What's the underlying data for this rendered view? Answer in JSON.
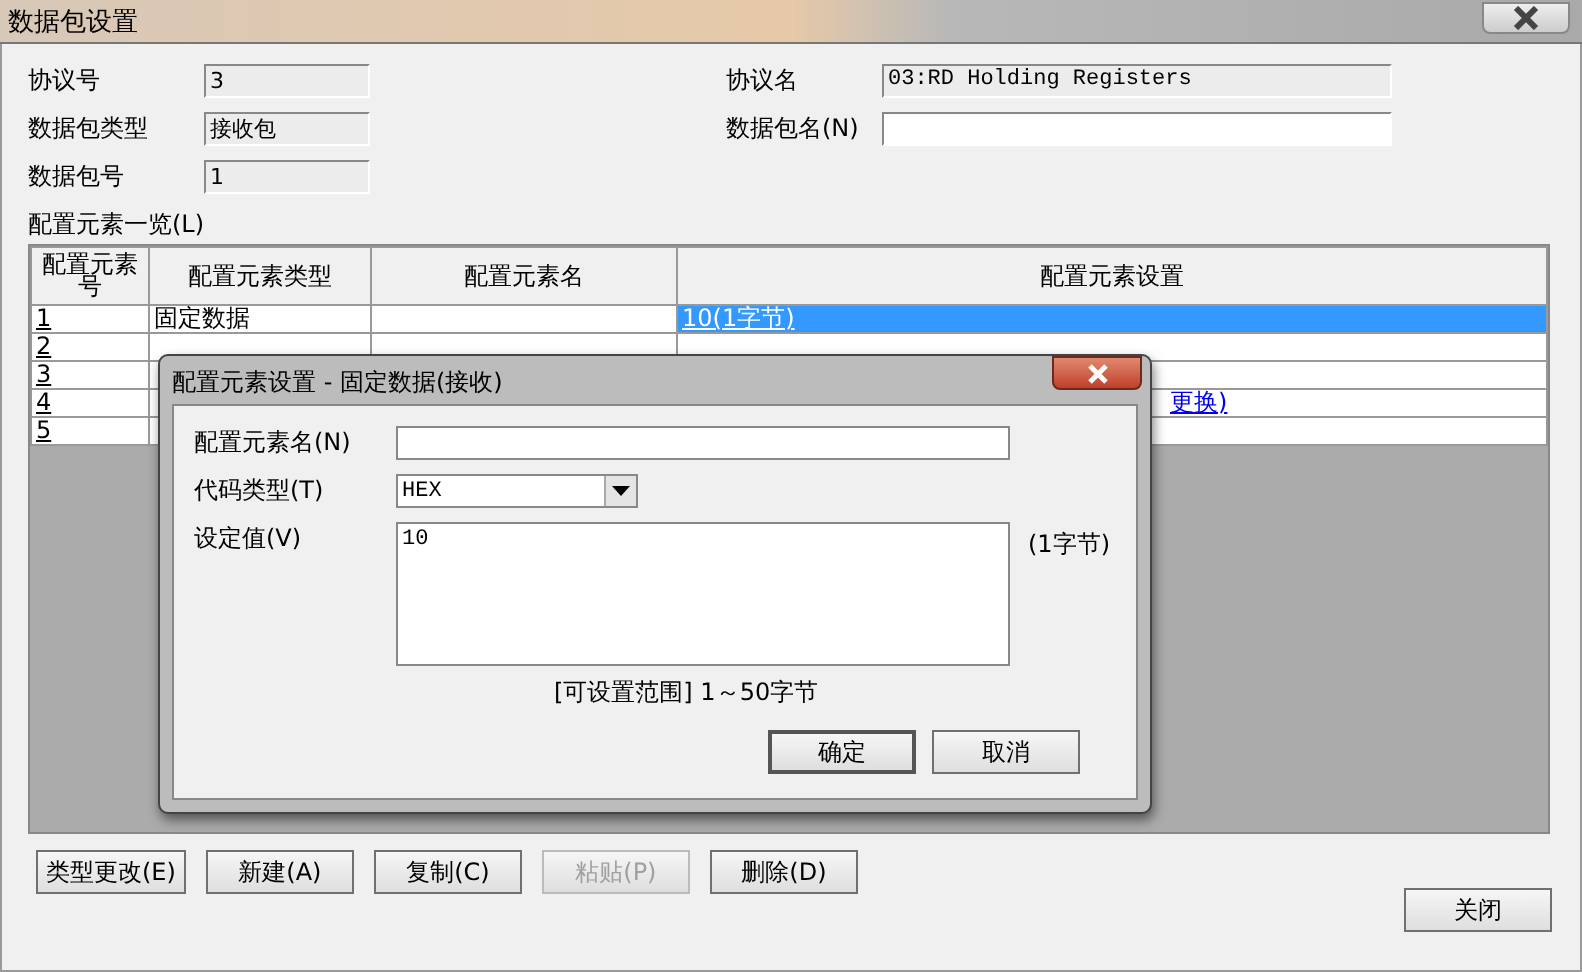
{
  "window": {
    "title": "数据包设置"
  },
  "fields_left": [
    {
      "label": "协议号",
      "value": "3"
    },
    {
      "label": "数据包类型",
      "value": "接收包"
    },
    {
      "label": "数据包号",
      "value": "1"
    }
  ],
  "fields_right": [
    {
      "label": "协议名",
      "value": "03:RD Holding Registers",
      "editable": false
    },
    {
      "label": "数据包名(N)",
      "editable": true
    }
  ],
  "list_label": "配置元素一览(L)",
  "table": {
    "columns": [
      "配置元素号",
      "配置元素类型",
      "配置元素名",
      "配置元素设置"
    ],
    "rows": [
      {
        "no": "1",
        "type": "固定数据",
        "setting": "10(1字节)",
        "selected": true
      },
      {
        "no": "2",
        "selected": false
      },
      {
        "no": "3",
        "selected": false
      },
      {
        "no": "4",
        "setting": "更换)",
        "selected": false
      },
      {
        "no": "5",
        "selected": false
      }
    ]
  },
  "buttons": [
    {
      "label": "类型更改(E)",
      "disabled": false
    },
    {
      "label": "新建(A)",
      "disabled": false
    },
    {
      "label": "复制(C)",
      "disabled": false
    },
    {
      "label": "粘贴(P)",
      "disabled": true
    },
    {
      "label": "删除(D)",
      "disabled": false
    }
  ],
  "close_button": "关闭",
  "dialog": {
    "title": "配置元素设置 - 固定数据(接收)",
    "name_label": "配置元素名(N)",
    "code_type_label": "代码类型(T)",
    "code_type": "HEX",
    "value_label": "设定值(V)",
    "value": "10",
    "unit": "(1字节)",
    "range": "[可设置范围] 1～50字节",
    "ok": "确定",
    "cancel": "取消"
  }
}
